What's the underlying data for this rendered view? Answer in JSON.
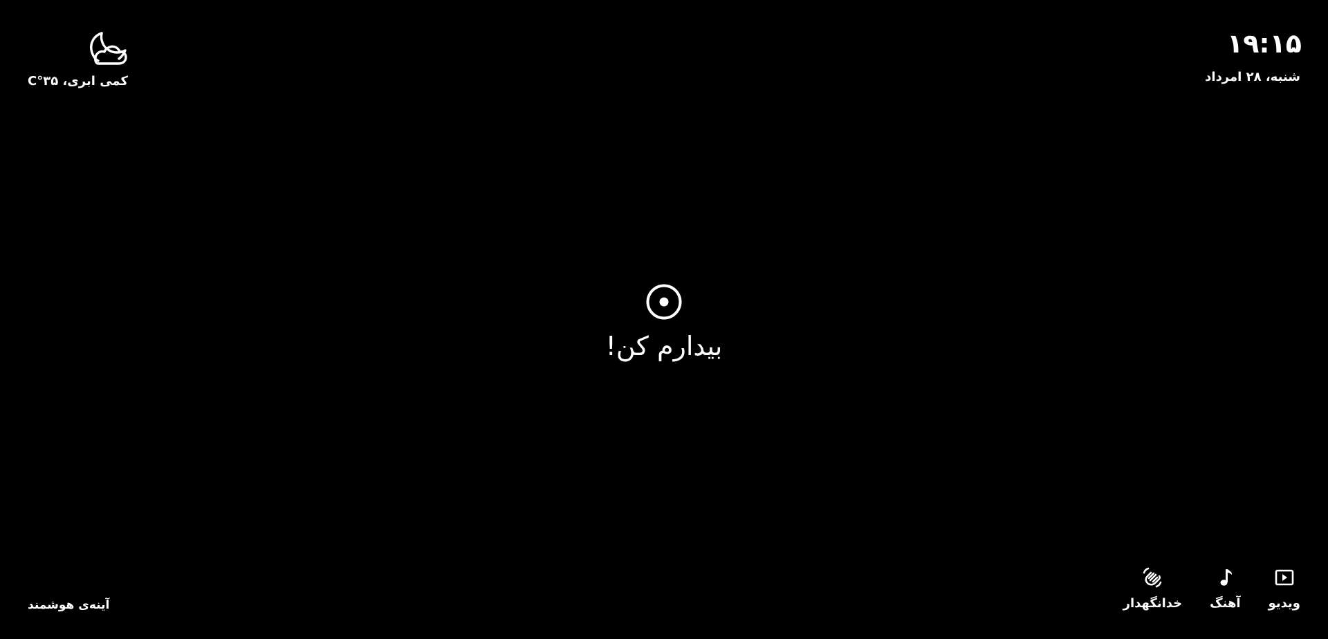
{
  "clock": {
    "time": "۱۹:۱۵",
    "date": "شنبه، ۲۸ امرداد"
  },
  "weather": {
    "icon": "moon-cloud-icon",
    "description": "کمی ابری، ۳۵°C"
  },
  "center": {
    "icon": "target-dot-icon",
    "message": "بیدارم کن!"
  },
  "brand": {
    "label": "آینه‌ی هوشمند"
  },
  "nav": {
    "items": [
      {
        "icon": "wave-hand-icon",
        "label": "خدانگهدار"
      },
      {
        "icon": "music-note-icon",
        "label": "آهنگ"
      },
      {
        "icon": "video-play-icon",
        "label": "ویدیو"
      }
    ]
  }
}
